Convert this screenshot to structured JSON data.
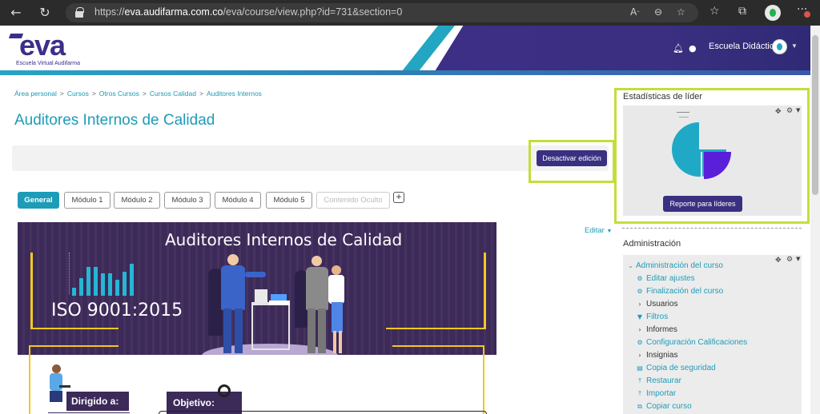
{
  "browser": {
    "url_prefix": "https://",
    "url_domain": "eva.audifarma.com.co",
    "url_path": "/eva/course/view.php?id=731&section=0",
    "icons": [
      "back-icon",
      "reload-icon",
      "lock-icon",
      "read-aloud-icon",
      "zoom-icon",
      "favorite-add-icon",
      "favorites-icon",
      "collections-icon",
      "profile-icon",
      "more-icon"
    ]
  },
  "header": {
    "logo_text": "eva",
    "logo_subtitle": "Escuela Virtual Audifarma",
    "user_name": "Escuela Didáctica",
    "brand_dark": "#3b2f8a",
    "brand_cyan": "#23a6c2"
  },
  "breadcrumb": [
    "Área personal",
    "Cursos",
    "Otros Cursos",
    "Cursos Calidad",
    "Auditores Internos"
  ],
  "page_title": "Auditores  Internos de Calidad",
  "edit_toggle_label": "Desactivar edición",
  "tabs": [
    {
      "label": "General",
      "active": true
    },
    {
      "label": "Módulo 1"
    },
    {
      "label": "Módulo 2"
    },
    {
      "label": "Módulo 3"
    },
    {
      "label": "Módulo 4"
    },
    {
      "label": "Módulo 5"
    },
    {
      "label": "Contenido Oculto",
      "hidden": true
    }
  ],
  "add_tab_label": "+",
  "edit_menu_label": "Editar",
  "banner": {
    "title": "Auditores Internos de Calidad",
    "iso_text": "ISO 9001:2015",
    "label_dirigido": "Dirigido a:",
    "label_objetivo": "Objetivo:"
  },
  "leader_stats": {
    "title": "Estadísticas de líder",
    "button_label": "Reporte para líderes"
  },
  "admin": {
    "title": "Administración",
    "course_admin_label": "Administración del curso",
    "items": [
      {
        "label": "Editar ajustes",
        "icon": "gear-icon",
        "link": true
      },
      {
        "label": "Finalización del curso",
        "icon": "gear-icon",
        "link": true
      },
      {
        "label": "Usuarios",
        "icon": "chevron-right-icon",
        "link": false
      },
      {
        "label": "Filtros",
        "icon": "filter-icon",
        "link": true
      },
      {
        "label": "Informes",
        "icon": "chevron-right-icon",
        "link": false
      },
      {
        "label": "Configuración Calificaciones",
        "icon": "gear-icon",
        "link": true
      },
      {
        "label": "Insignias",
        "icon": "chevron-right-icon",
        "link": false
      },
      {
        "label": "Copia de seguridad",
        "icon": "file-icon",
        "link": true
      },
      {
        "label": "Restaurar",
        "icon": "upload-icon",
        "link": true
      },
      {
        "label": "Importar",
        "icon": "upload-icon",
        "link": true
      },
      {
        "label": "Copiar curso",
        "icon": "copy-icon",
        "link": true
      }
    ]
  },
  "colors": {
    "accent": "#1d9cb8",
    "button": "#3a3081",
    "highlight": "#c5dd3a"
  }
}
